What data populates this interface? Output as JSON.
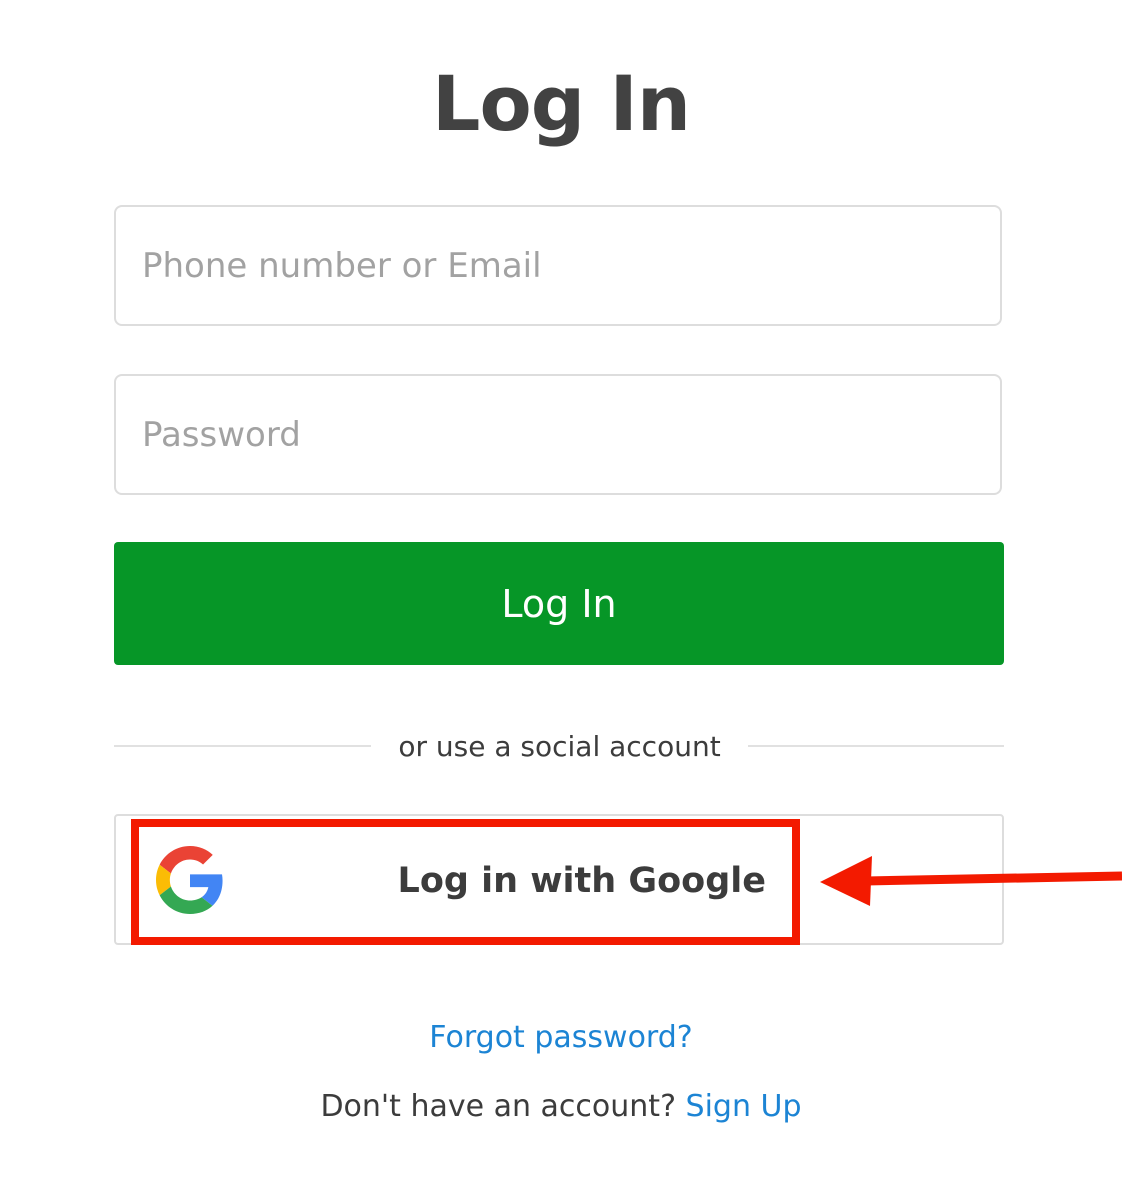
{
  "page": {
    "title": "Log In"
  },
  "form": {
    "email_placeholder": "Phone number or Email",
    "password_placeholder": "Password",
    "login_button": "Log In"
  },
  "social": {
    "divider_text": "or use a social account",
    "google_button": "Log in with Google",
    "google_icon": "google-g-icon"
  },
  "footer": {
    "forgot_password": "Forgot password?",
    "no_account_text": "Don't have an account?",
    "signup_link": "Sign Up"
  },
  "colors": {
    "primary_green": "#069627",
    "link_blue": "#1c84d4",
    "annotation_red": "#f31a00",
    "text_dark": "#424242"
  }
}
